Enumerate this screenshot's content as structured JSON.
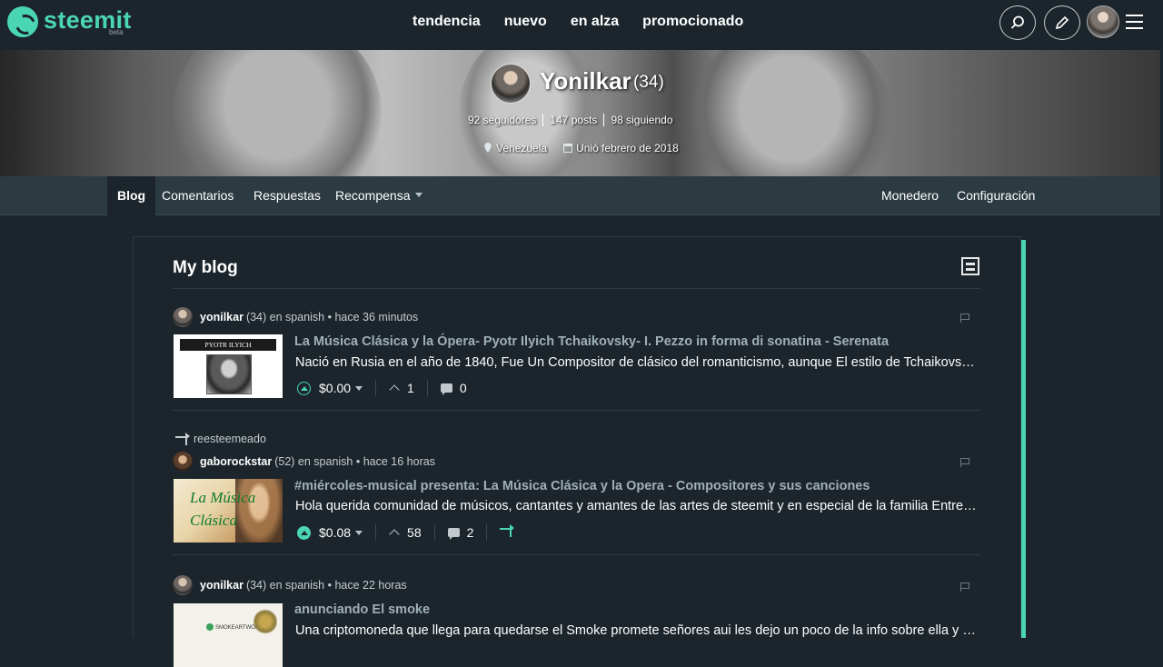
{
  "header": {
    "brand": "steemit",
    "beta": "beta",
    "nav": [
      "tendencia",
      "nuevo",
      "en alza",
      "promocionado"
    ]
  },
  "profile": {
    "name": "Yonilkar",
    "reputation": "(34)",
    "followers": "92 seguidores",
    "posts": "147 posts",
    "following": "98 siguiendo",
    "location": "Venezuela",
    "joined": "Unió febrero de 2018"
  },
  "subnav": {
    "blog": "Blog",
    "comments": "Comentarios",
    "replies": "Respuestas",
    "rewards": "Recompensa",
    "wallet": "Monedero",
    "settings": "Configuración"
  },
  "main": {
    "title": "My blog",
    "resteemed_label": "reesteemeado",
    "posts": [
      {
        "author": "yonilkar",
        "rep": "(34)",
        "meta": "en spanish • hace 36 minutos",
        "thumb_caption": "PYOTR ILYICH TCHAIKOVSKY",
        "title": "La Música Clásica y la Ópera- Pyotr Ilyich Tchaikovsky- I. Pezzo in forma di sonatina - Serenata",
        "body": "Nació en Rusia en el año de 1840, Fue Un Compositor de clásico del romanticismo, aunque El estilo de Tchaikovsky evolucionó",
        "payout": "$0.00",
        "votes": "1",
        "comments": "0"
      },
      {
        "author": "gaborockstar",
        "rep": "(52)",
        "meta": "en spanish • hace 16 horas",
        "thumb_caption": "La Música Clásica",
        "title": "#miércoles-musical presenta: La Música Clásica y la Opera - Compositores y sus canciones",
        "body": "Hola querida comunidad de músicos, cantantes y amantes de las artes de steemit y en especial de la familia Entre Músicos",
        "payout": "$0.08",
        "votes": "58",
        "comments": "2"
      },
      {
        "author": "yonilkar",
        "rep": "(34)",
        "meta": "en spanish • hace 22 horas",
        "thumb_caption": "SMOKEARTWORK",
        "title": "anunciando El smoke",
        "body": "Una criptomoneda que llega para quedarse el Smoke promete señores aui les dejo un poco de la info sobre ella y como funciona"
      }
    ]
  },
  "colors": {
    "accent": "#4bd6b2",
    "background": "#1c252b",
    "subnav": "#2c3a42",
    "title_link": "#9fb0b8"
  }
}
